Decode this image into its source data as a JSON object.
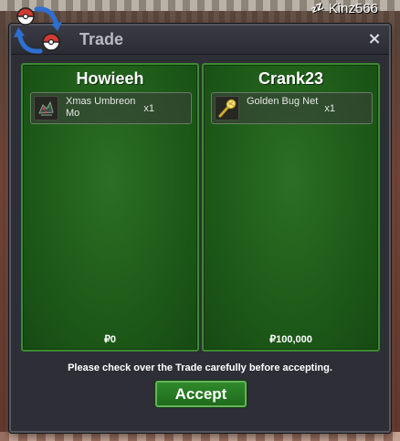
{
  "player": {
    "name": "Kinz566"
  },
  "window": {
    "title": "Trade",
    "close_glyph": "×"
  },
  "trade": {
    "left": {
      "name": "Howieeh",
      "item": {
        "name": "Xmas Umbreon Mo",
        "qty": "x1",
        "icon": "umbreon-mount-icon"
      },
      "money": "₽0"
    },
    "right": {
      "name": "Crank23",
      "item": {
        "name": "Golden Bug Net",
        "qty": "x1",
        "icon": "golden-bug-net-icon"
      },
      "money": "₽100,000"
    }
  },
  "notice": "Please check over the Trade carefully before accepting.",
  "accept_label": "Accept",
  "colors": {
    "panel_green": "#1d5a18",
    "panel_border": "#3d8a32",
    "window_bg": "#2d2e36",
    "accept_green": "#2f8a2a"
  }
}
